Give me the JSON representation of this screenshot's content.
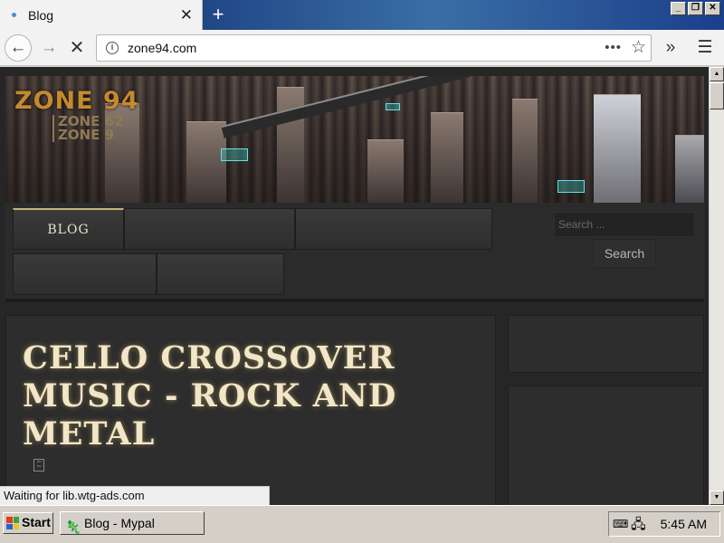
{
  "browser": {
    "tab_title": "Blog",
    "new_tab": "+",
    "url": "zone94.com",
    "status_text": "Waiting for lib.wtg-ads.com"
  },
  "site": {
    "logo_main": "ZONE 94",
    "logo_sub1": "ZONE 62",
    "logo_sub2": "ZONE 9",
    "nav_items": [
      "BLOG",
      "",
      "",
      "",
      ""
    ],
    "search_placeholder": "Search ...",
    "search_button": "Search",
    "post_title": "CELLO CROSSOVER MUSIC - ROCK AND METAL"
  },
  "taskbar": {
    "start_label": "Start",
    "task_label": "Blog - Mypal",
    "clock": "5:45 AM"
  },
  "colors": {
    "accent_gold": "#c9b37a",
    "title_text": "#f2e6c8",
    "page_bg": "#262626",
    "titlebar_blue": "#0a246a"
  },
  "icons": {
    "tab_favicon": "globe-dot-icon",
    "tab_close": "close-icon",
    "back": "arrow-left-icon",
    "forward": "arrow-right-icon",
    "stop": "stop-icon",
    "site_info": "info-icon",
    "page_actions": "more-dots-icon",
    "bookmark": "star-icon",
    "overflow": "chevron-double-right-icon",
    "menu": "hamburger-icon"
  }
}
